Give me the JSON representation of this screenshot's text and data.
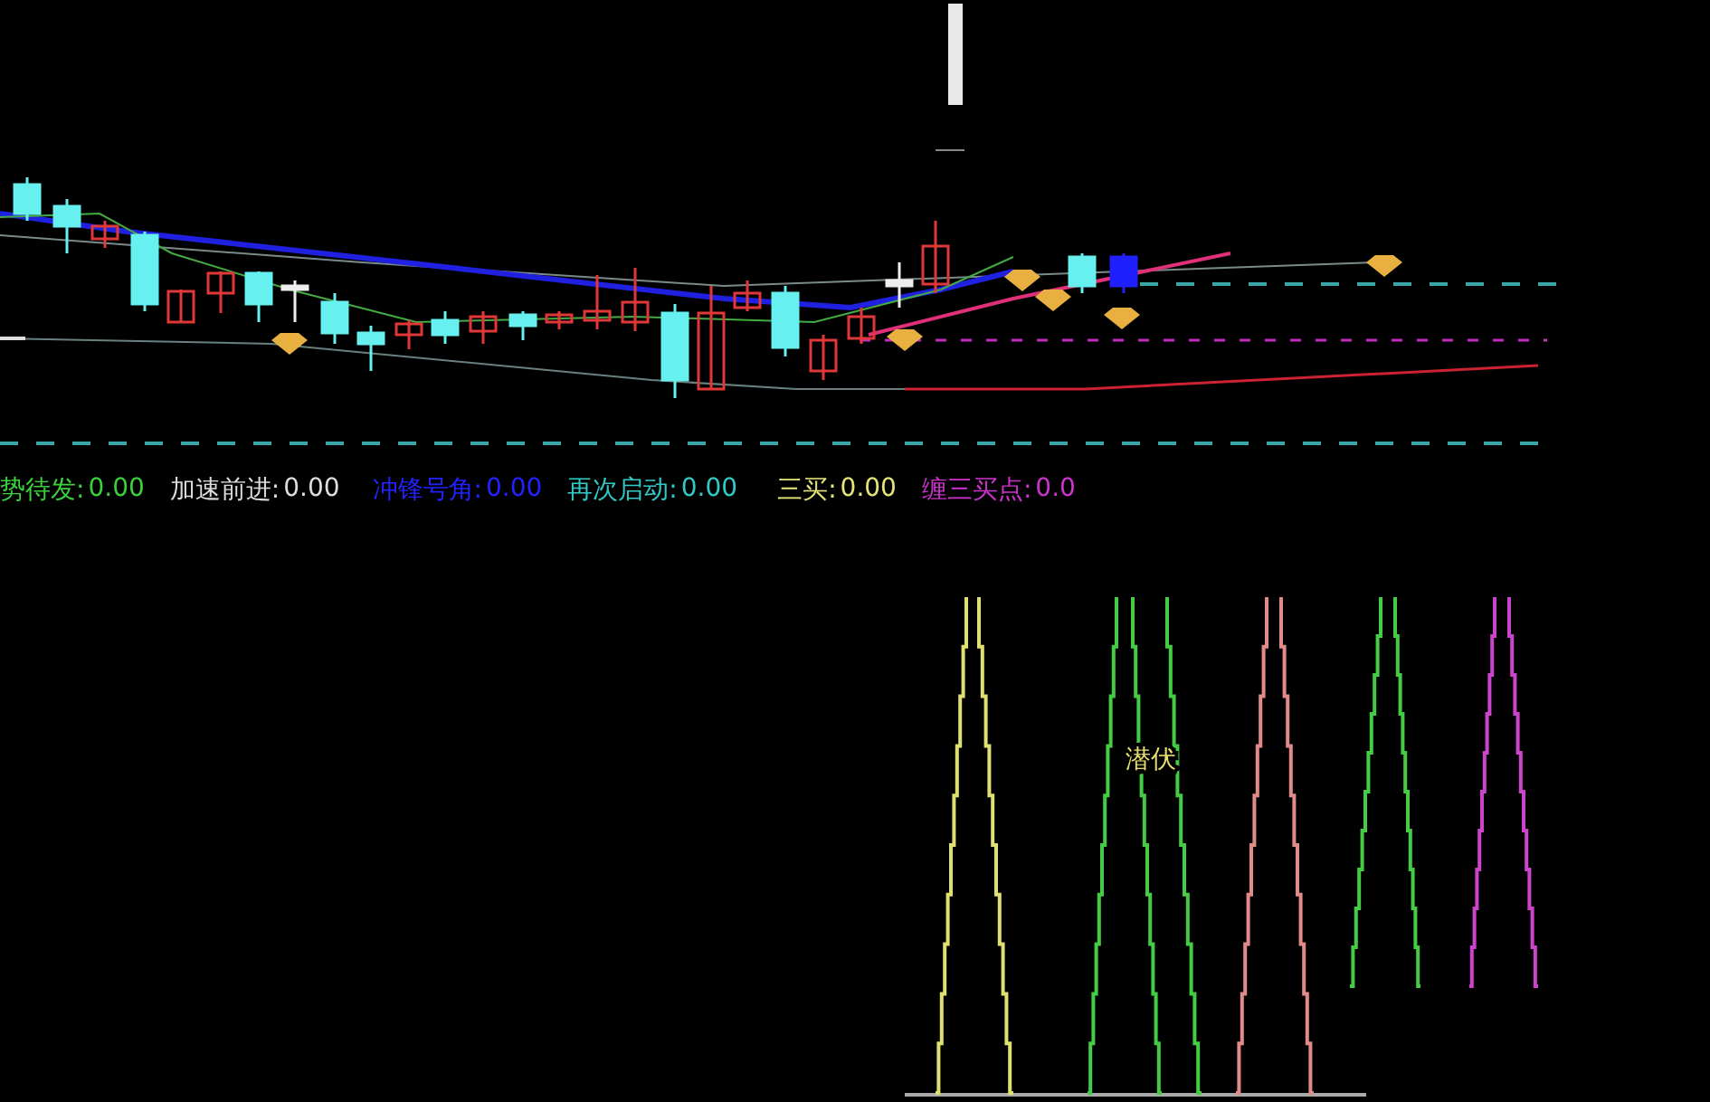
{
  "indicator_legend": [
    {
      "name": "势待发:",
      "value": "0.00",
      "color": "#3ccf3c"
    },
    {
      "name": "加速前进:",
      "value": "0.00",
      "color": "#dddddd"
    },
    {
      "name": "冲锋号角:",
      "value": "0.00",
      "color": "#2222ff"
    },
    {
      "name": "再次启动:",
      "value": "0.00",
      "color": "#33c8c8"
    },
    {
      "name": "三买:",
      "value": "0.00",
      "color": "#e4e47a"
    },
    {
      "name": "缠三买点:",
      "value": "0.0",
      "color": "#cc33cc"
    }
  ],
  "signal_panel": {
    "label": "潜伏"
  }
}
